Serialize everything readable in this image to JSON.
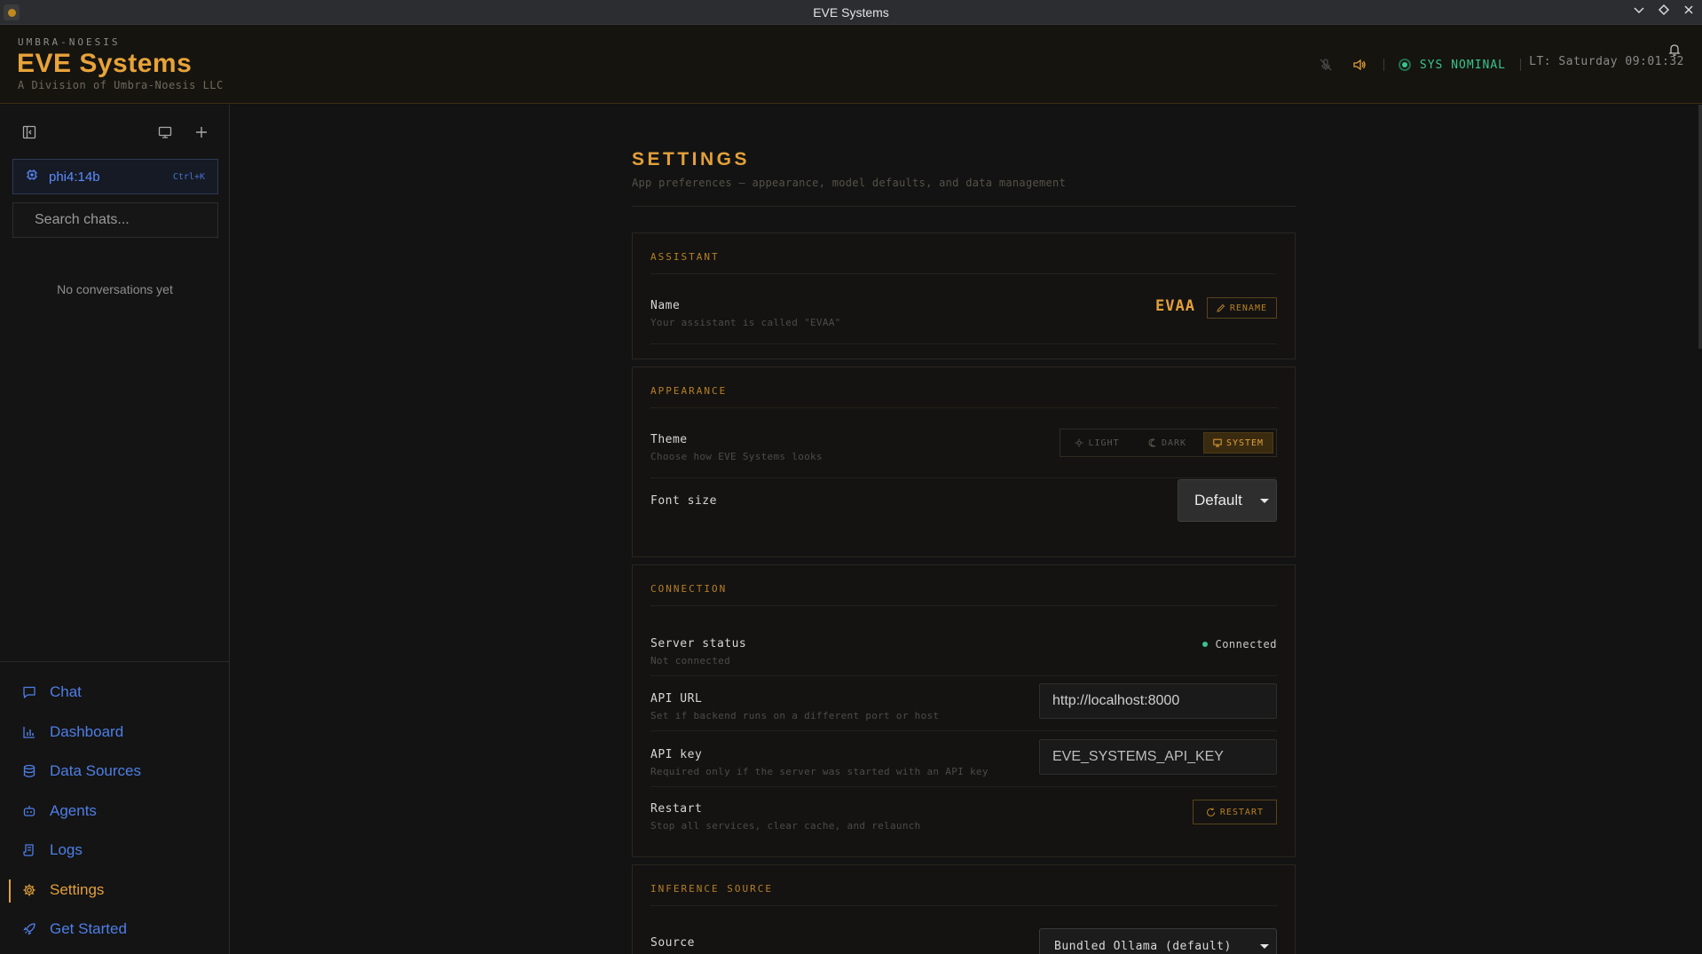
{
  "window": {
    "title": "EVE Systems",
    "controls": [
      "chevron-down",
      "diamond",
      "close"
    ]
  },
  "header": {
    "org": "UMBRA-NOESIS",
    "brand": "EVE Systems",
    "division": "A Division of Umbra-Noesis LLC",
    "sys_status": "SYS NOMINAL",
    "clock": "LT: Saturday 09:01:32"
  },
  "sidebar": {
    "model": {
      "name": "phi4:14b",
      "shortcut": "Ctrl+K"
    },
    "search_placeholder": "Search chats...",
    "empty_text": "No conversations yet",
    "nav": [
      {
        "label": "Chat",
        "icon": "chat-bubble-icon",
        "active": false
      },
      {
        "label": "Dashboard",
        "icon": "bar-chart-icon",
        "active": false
      },
      {
        "label": "Data Sources",
        "icon": "database-icon",
        "active": false
      },
      {
        "label": "Agents",
        "icon": "robot-icon",
        "active": false
      },
      {
        "label": "Logs",
        "icon": "scroll-icon",
        "active": false
      },
      {
        "label": "Settings",
        "icon": "gear-icon",
        "active": true
      },
      {
        "label": "Get Started",
        "icon": "rocket-icon",
        "active": false
      }
    ]
  },
  "settings": {
    "title": "SETTINGS",
    "subtitle": "App preferences — appearance, model defaults, and data management",
    "assistant": {
      "section": "ASSISTANT",
      "name_title": "Name",
      "name_desc": "Your assistant is called \"EVAA\"",
      "name_value": "EVAA",
      "rename_label": "RENAME"
    },
    "appearance": {
      "section": "APPEARANCE",
      "theme_title": "Theme",
      "theme_desc": "Choose how EVE Systems looks",
      "theme_options": [
        "LIGHT",
        "DARK",
        "SYSTEM"
      ],
      "theme_selected": "SYSTEM",
      "font_title": "Font size",
      "font_value": "Default"
    },
    "connection": {
      "section": "CONNECTION",
      "server_title": "Server status",
      "server_desc": "Not connected",
      "server_status": "Connected",
      "api_url_title": "API URL",
      "api_url_desc": "Set if backend runs on a different port or host",
      "api_url_value": "http://localhost:8000",
      "api_key_title": "API key",
      "api_key_desc": "Required only if the server was started with an API key",
      "api_key_placeholder": "EVE_SYSTEMS_API_KEY",
      "restart_title": "Restart",
      "restart_desc": "Stop all services, clear cache, and relaunch",
      "restart_label": "RESTART"
    },
    "inference": {
      "section": "INFERENCE SOURCE",
      "source_title": "Source",
      "source_value": "Bundled Ollama (default)"
    }
  },
  "colors": {
    "accent": "#e3a03a",
    "link": "#4e7ee6",
    "status_ok": "#38c48c"
  }
}
